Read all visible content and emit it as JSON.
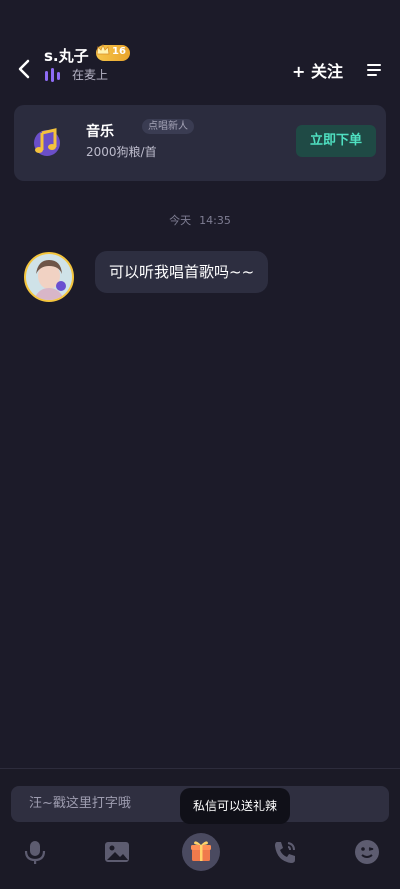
{
  "header": {
    "name": "s.丸子",
    "level": "16",
    "status": "在麦上",
    "follow_label": "+ 关注"
  },
  "service_card": {
    "title": "音乐",
    "tag": "点唱新人",
    "price": "2000狗粮/首",
    "order_button": "立即下单"
  },
  "timestamp": {
    "day": "今天",
    "time": "14:35"
  },
  "message": {
    "text": "可以听我唱首歌吗~~"
  },
  "composer": {
    "placeholder": "汪~戳这里打字哦",
    "gift_tooltip": "私信可以送礼辣"
  },
  "icons": {
    "back": "chevron-left-icon",
    "menu": "menu-icon",
    "music": "music-note-icon",
    "voice": "microphone-icon",
    "image": "image-icon",
    "gift": "gift-icon",
    "call": "phone-call-icon",
    "emoji": "emoji-icon"
  },
  "colors": {
    "background": "#1c1b29",
    "card": "#2b2c3e",
    "accent_green": "#4fe0c1",
    "badge_gold": "#f6c64b"
  }
}
